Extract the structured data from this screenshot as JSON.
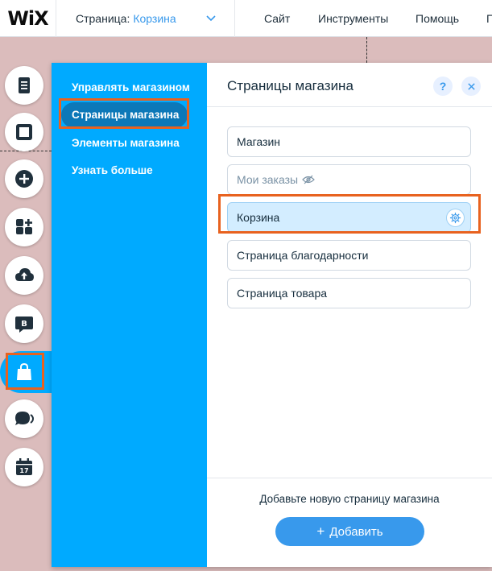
{
  "topbar": {
    "logo": "WiX",
    "page_label": "Страница:",
    "page_current": "Корзина",
    "nav": [
      "Сайт",
      "Инструменты",
      "Помощь",
      "П"
    ]
  },
  "sidebar": {
    "icons": [
      "pages-icon",
      "background-icon",
      "add-icon",
      "app-market-icon",
      "upload-icon",
      "blog-icon",
      "store-icon",
      "chat-icon",
      "bookings-icon"
    ],
    "blog_letter": "B",
    "calendar_day": "17"
  },
  "panel": {
    "nav": [
      {
        "label": "Управлять магазином"
      },
      {
        "label": "Страницы магазина",
        "selected": true
      },
      {
        "label": "Элементы магазина"
      },
      {
        "label": "Узнать больше"
      }
    ],
    "title": "Страницы магазина",
    "help": "?",
    "pages": [
      {
        "label": "Магазин"
      },
      {
        "label": "Мои заказы",
        "hidden": true
      },
      {
        "label": "Корзина",
        "active": true
      },
      {
        "label": "Страница благодарности"
      },
      {
        "label": "Страница товара"
      }
    ],
    "footer_hint": "Добавьте новую страницу магазина",
    "add_button": "Добавить",
    "add_plus": "+"
  },
  "colors": {
    "accent": "#00aaff",
    "button": "#3899ec",
    "highlight": "#e8621f",
    "canvas": "#dbbcbc"
  }
}
